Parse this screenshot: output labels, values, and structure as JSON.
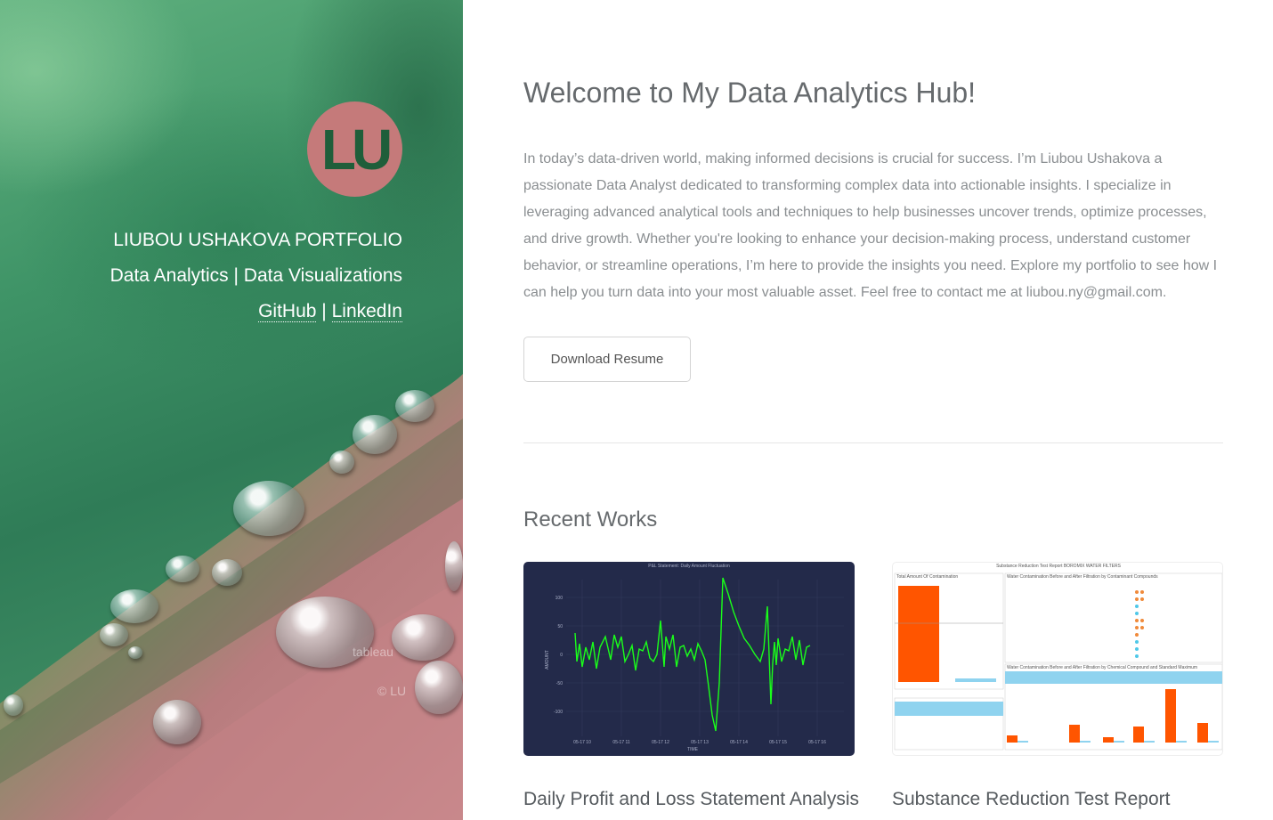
{
  "hero": {
    "logo_text": "LU",
    "name": "LIUBOU USHAKOVA PORTFOLIO",
    "subtitle": "Data Analytics | Data Visualizations",
    "links": [
      {
        "label": "GitHub"
      },
      {
        "label": "LinkedIn"
      }
    ],
    "link_separator": "|",
    "watermark_brand": "tableau",
    "watermark_copy": "© LU"
  },
  "main": {
    "welcome_title": "Welcome to My Data Analytics Hub!",
    "intro_text": "In today’s data-driven world, making informed decisions is crucial for success. I’m Liubou Ushakova a passionate Data Analyst dedicated to transforming complex data into actionable insights. I specialize in leveraging advanced analytical tools and techniques to help businesses uncover trends, optimize processes, and drive growth. Whether you're looking to enhance your decision-making process, understand customer behavior, or streamline operations, I’m here to provide the insights you need. Explore my portfolio to see how I can help you turn data into your most valuable asset. Feel free to contact me at liubou.ny@gmail.com.",
    "resume_button": "Download Resume",
    "recent_works_title": "Recent Works",
    "works": [
      {
        "title": "Daily Profit and Loss Statement Analysis",
        "thumb": {
          "chart_title": "P&L Statement: Daily Amount Fluctuation",
          "y_label": "AMOUNT",
          "x_label": "TIME",
          "y_ticks": [
            "100",
            "50",
            "0",
            "-50",
            "-100"
          ],
          "x_ticks": [
            "05-17 10",
            "05-17 11",
            "05-17 12",
            "05-17 13",
            "05-17 14",
            "05-17 15",
            "05-17 16"
          ]
        }
      },
      {
        "title": "Substance Reduction Test Report",
        "thumb": {
          "report_title": "Substance Reduction Test Report BOROMIX WATER FILTERS",
          "left_panel_title": "Total Amount Of Contamination",
          "right_panel_title": "Water Contamination Before and After Filtration by Contaminant Compounds",
          "bottom_panel_title": "Water Contamination Before and After Filtration by Chemical Compound and Standard Maximum"
        }
      }
    ]
  },
  "colors": {
    "accent_badge": "#c57a7a",
    "badge_text": "#1f5e3a",
    "chart_bg": "#232a4a",
    "chart_line": "#1aff1a",
    "report_bar": "#ff5500",
    "report_header": "#8fd3ef"
  }
}
